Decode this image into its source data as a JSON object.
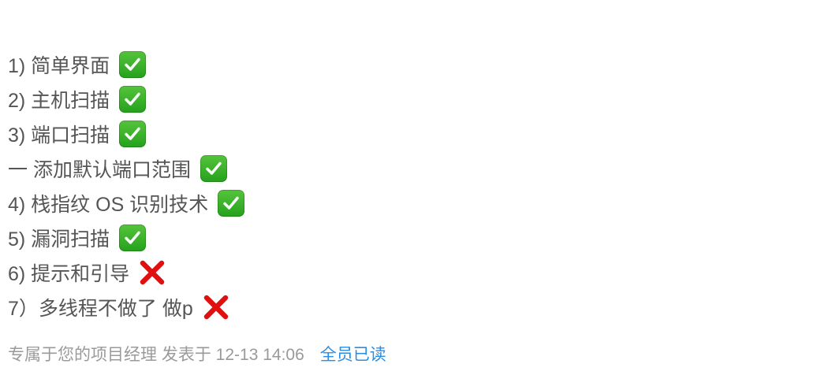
{
  "message": {
    "lines": [
      {
        "text": "1) 简单界面",
        "status": "check-icon"
      },
      {
        "text": "2) 主机扫描",
        "status": "check-icon"
      },
      {
        "text": "3) 端口扫描",
        "status": "check-icon"
      },
      {
        "text": "一 添加默认端口范围",
        "status": "check-icon"
      },
      {
        "text": "4) 栈指纹 OS 识别技术",
        "status": "check-icon"
      },
      {
        "text": "5) 漏洞扫描",
        "status": "check-icon"
      },
      {
        "text": "6) 提示和引导",
        "status": "cross-icon"
      },
      {
        "text": "7）多线程不做了 做p",
        "status": "cross-icon"
      }
    ]
  },
  "footer": {
    "author_posted": "专属于您的项目经理 发表于 12-13 14:06",
    "read_status": "全员已读"
  },
  "colors": {
    "text": "#555555",
    "meta": "#9a9a9a",
    "link": "#2b8de0",
    "check": "#3bb52d",
    "cross": "#e01010"
  }
}
